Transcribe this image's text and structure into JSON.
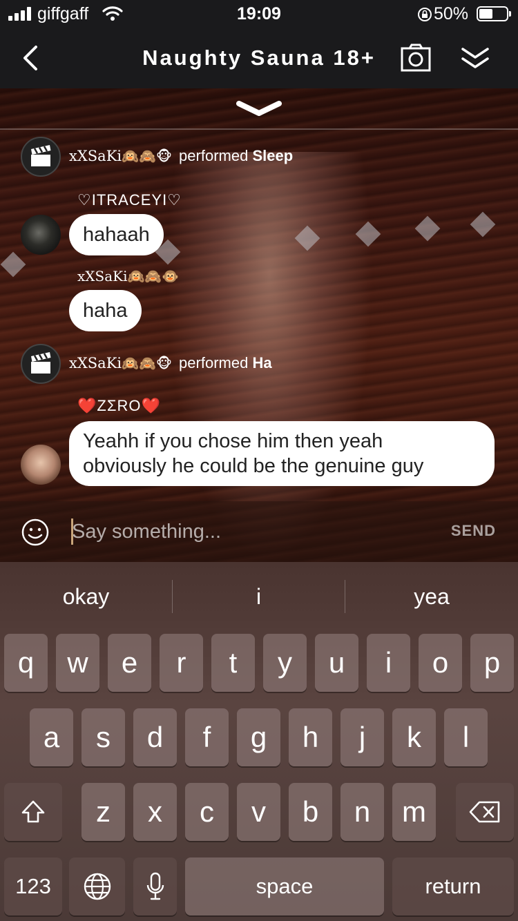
{
  "status": {
    "carrier": "giffgaff",
    "time": "19:09",
    "battery": "50%"
  },
  "header": {
    "title": "Naughty Sauna 18+"
  },
  "chat": {
    "messages": [
      {
        "type": "system",
        "user": "xXSaKi",
        "emoji": "🙉🙈🐵",
        "action": "performed",
        "item": "Sleep"
      },
      {
        "type": "message",
        "user": "♡ITRACEYI♡",
        "text": "hahaah"
      },
      {
        "type": "message",
        "user": "xXSaKi🙉🙈🐵",
        "text": "haha"
      },
      {
        "type": "system",
        "user": "xXSaKi",
        "emoji": "🙉🙈🐵",
        "action": "performed",
        "item": "Ha"
      },
      {
        "type": "message",
        "user_heart": "❤️",
        "user": "ZΣRO",
        "text_line1": "Yeahh if you chose him then yeah",
        "text_line2": "obviously he could be the genuine guy"
      }
    ]
  },
  "input": {
    "placeholder": "Say something...",
    "send": "SEND"
  },
  "keyboard": {
    "suggestions": [
      "okay",
      "i",
      "yea"
    ],
    "row1": [
      "q",
      "w",
      "e",
      "r",
      "t",
      "y",
      "u",
      "i",
      "o",
      "p"
    ],
    "row2": [
      "a",
      "s",
      "d",
      "f",
      "g",
      "h",
      "j",
      "k",
      "l"
    ],
    "row3": [
      "z",
      "x",
      "c",
      "v",
      "b",
      "n",
      "m"
    ],
    "numbers": "123",
    "space": "space",
    "return": "return"
  }
}
